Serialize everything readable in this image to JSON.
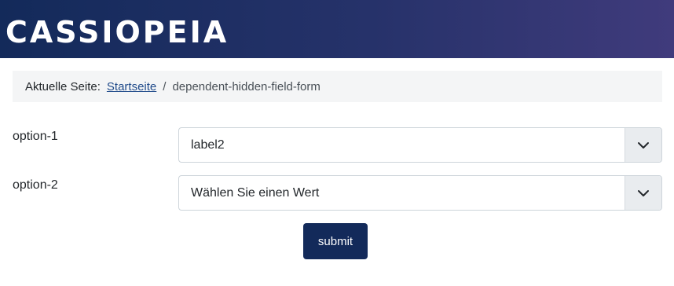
{
  "header": {
    "brand": "CASSIOPEIA"
  },
  "breadcrumb": {
    "prefix": "Aktuelle Seite:",
    "home": "Startseite",
    "separator": "/",
    "current": "dependent-hidden-field-form"
  },
  "form": {
    "option1": {
      "label": "option-1",
      "selected": "label2"
    },
    "option2": {
      "label": "option-2",
      "selected": "Wählen Sie einen Wert"
    },
    "submit_label": "submit"
  },
  "colors": {
    "header_start": "#132a5a",
    "header_end": "#403b7c",
    "button": "#132a5a",
    "link": "#1f4a8a"
  },
  "icons": {
    "select_arrow": "chevron-down-icon"
  }
}
